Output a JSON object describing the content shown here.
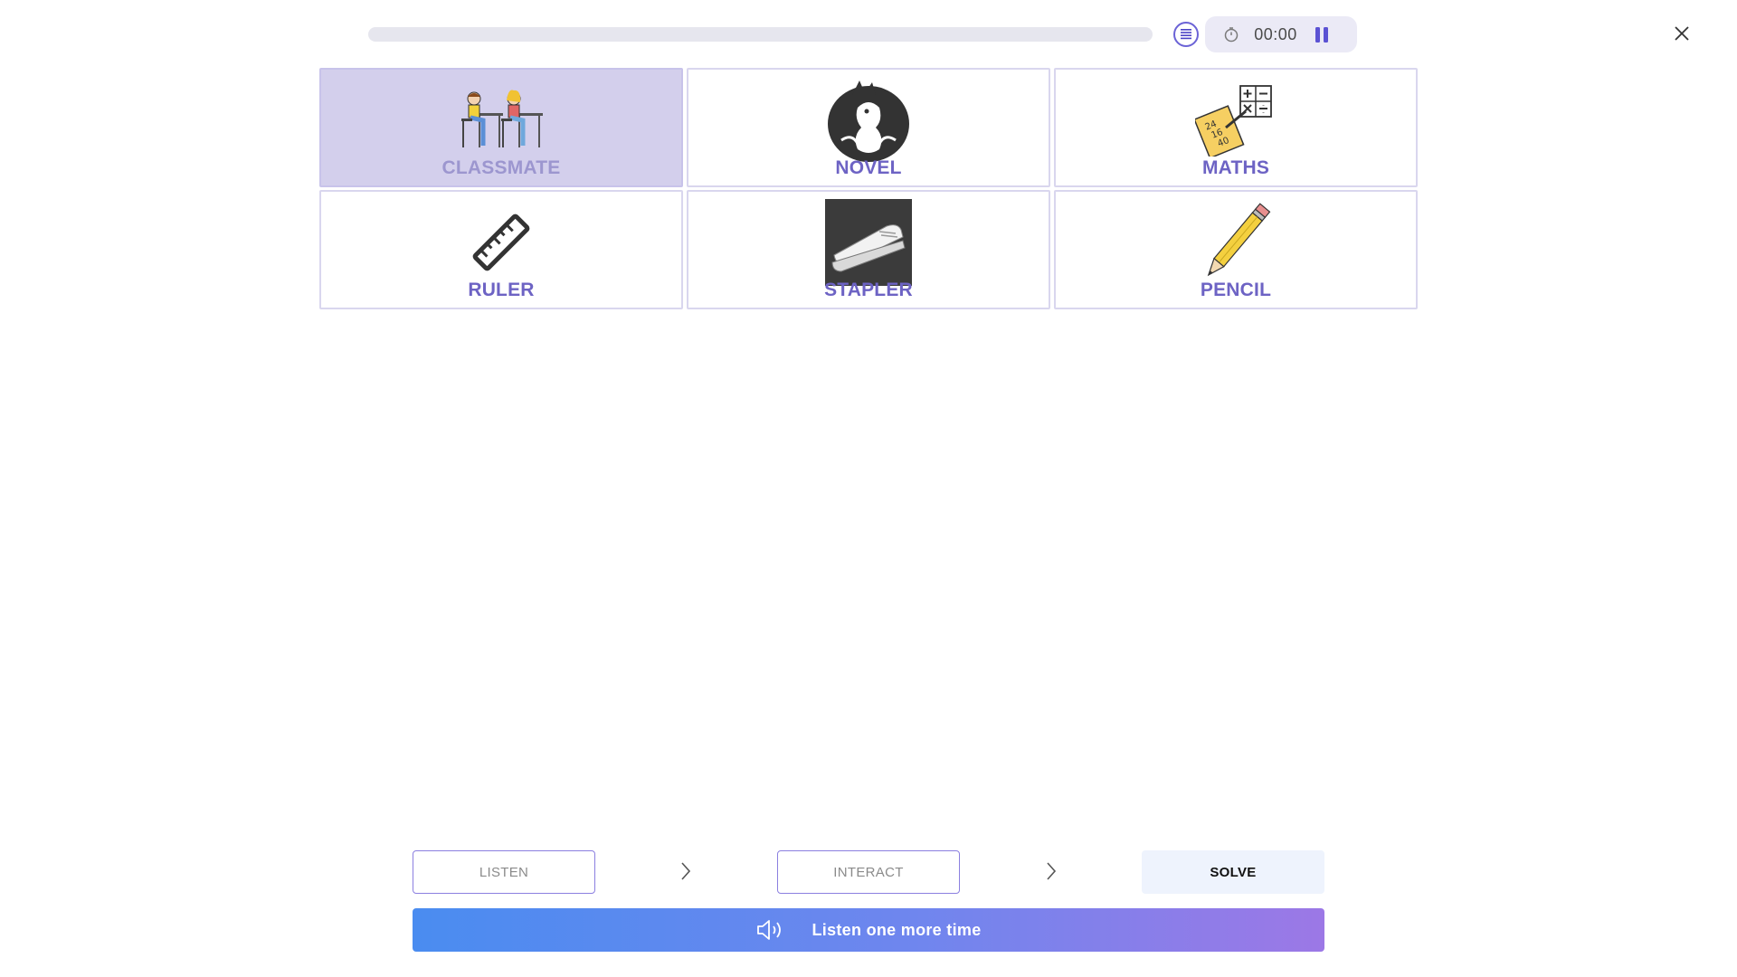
{
  "header": {
    "progress_percent": 0,
    "timer": "00:00",
    "menu_icon": "list-icon",
    "timer_icon": "stopwatch-icon",
    "pause_icon": "pause-icon",
    "close_icon": "close-icon"
  },
  "cards": [
    {
      "label": "CLASSMATE",
      "icon": "classmates-at-desks-icon",
      "selected": true
    },
    {
      "label": "NOVEL",
      "icon": "dragon-book-icon",
      "selected": false
    },
    {
      "label": "MATHS",
      "icon": "maths-worksheet-icon",
      "selected": false
    },
    {
      "label": "RULER",
      "icon": "ruler-icon",
      "selected": false
    },
    {
      "label": "STAPLER",
      "icon": "stapler-icon",
      "selected": false
    },
    {
      "label": "PENCIL",
      "icon": "pencil-icon",
      "selected": false
    }
  ],
  "steps": {
    "listen": "LISTEN",
    "interact": "INTERACT",
    "solve": "SOLVE"
  },
  "listen_again": {
    "label": "Listen one more time",
    "icon": "speaker-icon"
  },
  "colors": {
    "accent": "#6d63c4",
    "selected_card": "#d3cfec",
    "gradient_start": "#4a8cf0",
    "gradient_end": "#9c78e6"
  }
}
